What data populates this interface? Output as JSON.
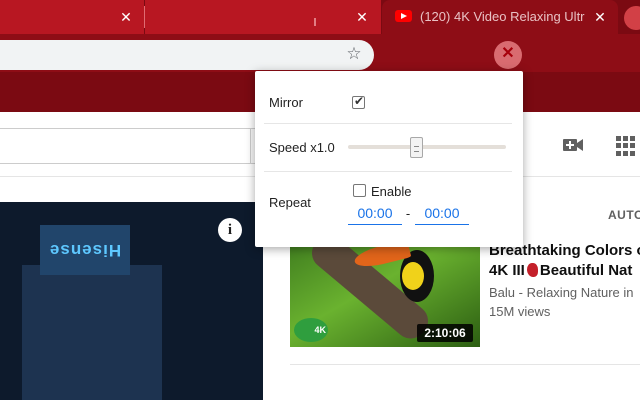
{
  "browser": {
    "tabs": [
      {
        "label": "",
        "close": "✕"
      },
      {
        "label": "",
        "close": "✕"
      },
      {
        "label": "(120) 4K Video Relaxing Ultr",
        "close": "✕"
      }
    ],
    "star_glyph": "☆",
    "extension_glyph": "✕"
  },
  "popup": {
    "mirror": {
      "label": "Mirror",
      "checked": true
    },
    "speed": {
      "label": "Speed x1.0",
      "value": 1.0,
      "fraction": 0.43
    },
    "repeat": {
      "label": "Repeat",
      "enable_label": "Enable",
      "enabled": false,
      "start": "00:00",
      "separator": "-",
      "end": "00:00"
    }
  },
  "player": {
    "info_glyph": "i",
    "sign_text": "Hisense"
  },
  "sidebar": {
    "autoplay_label": "AUTO",
    "video": {
      "title_line1": "Breathtaking Colors o",
      "title_line2_a": "4K III",
      "title_line2_b": "Beautiful Nat",
      "channel": "Balu - Relaxing Nature in",
      "views": "15M views",
      "duration": "2:10:06",
      "badge": "4K"
    }
  },
  "colors": {
    "brand": "#b81722",
    "frame": "#7b0a12",
    "accent": "#1a73e8"
  }
}
